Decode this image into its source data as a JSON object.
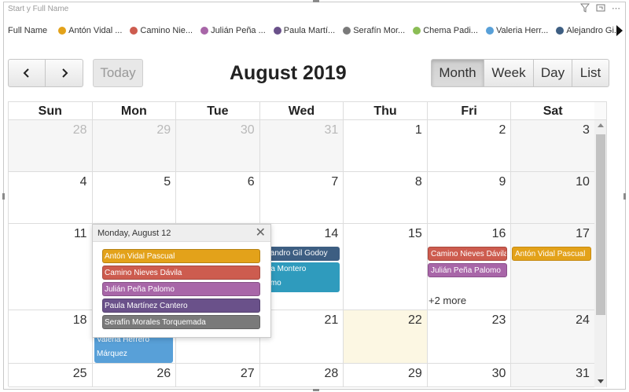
{
  "visual": {
    "title": "Start y Full Name"
  },
  "legend": {
    "title": "Full Name",
    "items": [
      {
        "label": "Antón Vidal ...",
        "color": "#e3a21a"
      },
      {
        "label": "Camino Nie...",
        "color": "#cd5c4f"
      },
      {
        "label": "Julián Peña ...",
        "color": "#a866a8"
      },
      {
        "label": "Paula Martí...",
        "color": "#6a518a"
      },
      {
        "label": "Serafín Mor...",
        "color": "#7a7a7a"
      },
      {
        "label": "Chema Padi...",
        "color": "#8bbd55"
      },
      {
        "label": "Valeria Herr...",
        "color": "#58a0d8"
      },
      {
        "label": "Alejandro Gi...",
        "color": "#3d5e82"
      }
    ]
  },
  "toolbar": {
    "prev_icon": "chevron-left-icon",
    "next_icon": "chevron-right-icon",
    "today_label": "Today",
    "title": "August 2019",
    "views": [
      "Month",
      "Week",
      "Day",
      "List"
    ],
    "active_view": "Month"
  },
  "calendar": {
    "days_of_week": [
      "Sun",
      "Mon",
      "Tue",
      "Wed",
      "Thu",
      "Fri",
      "Sat"
    ],
    "weeks": [
      [
        "28",
        "29",
        "30",
        "31",
        "1",
        "2",
        "3"
      ],
      [
        "4",
        "5",
        "6",
        "7",
        "8",
        "9",
        "10"
      ],
      [
        "11",
        "12",
        "13",
        "14",
        "15",
        "16",
        "17"
      ],
      [
        "18",
        "19",
        "20",
        "21",
        "22",
        "23",
        "24"
      ],
      [
        "25",
        "26",
        "27",
        "28",
        "29",
        "30",
        "31"
      ]
    ],
    "events": {
      "wed_14_a": "ejandro Gil Godoy",
      "wed_14_b": "ma Montero\nlomo",
      "fri_16_a": "Camino Nieves Dávila",
      "fri_16_b": "Julián Peña Palomo",
      "fri_16_more": "+2 more",
      "sat_17_a": "Antón Vidal Pascual",
      "mon_19": "Valeria Herrero\nMárquez"
    }
  },
  "popover": {
    "date": "Monday, August 12",
    "events": [
      {
        "label": "Antón Vidal Pascual",
        "color": "#e3a21a"
      },
      {
        "label": "Camino Nieves Dávila",
        "color": "#cd5c4f"
      },
      {
        "label": "Julián Peña Palomo",
        "color": "#a866a8"
      },
      {
        "label": "Paula Martínez Cantero",
        "color": "#6a518a"
      },
      {
        "label": "Serafín Morales Torquemada",
        "color": "#7a7a7a"
      }
    ]
  }
}
